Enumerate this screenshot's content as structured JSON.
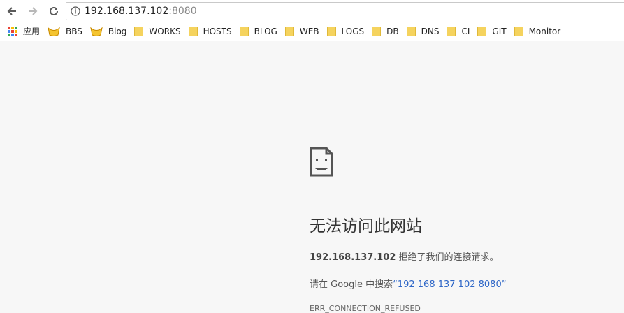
{
  "toolbar": {
    "back_icon": "arrow-left-icon",
    "forward_icon": "arrow-right-icon",
    "reload_icon": "reload-icon",
    "info_icon": "info-icon",
    "url_host": "192.168.137.102",
    "url_port": ":8080"
  },
  "bookmarks": {
    "apps_label": "应用",
    "items": [
      {
        "label": "BBS",
        "icon": "bbs-icon"
      },
      {
        "label": "Blog",
        "icon": "blog-icon"
      },
      {
        "label": "WORKS",
        "icon": "folder-icon"
      },
      {
        "label": "HOSTS",
        "icon": "folder-icon"
      },
      {
        "label": "BLOG",
        "icon": "folder-icon"
      },
      {
        "label": "WEB",
        "icon": "folder-icon"
      },
      {
        "label": "LOGS",
        "icon": "folder-icon"
      },
      {
        "label": "DB",
        "icon": "folder-icon"
      },
      {
        "label": "DNS",
        "icon": "folder-icon"
      },
      {
        "label": "CI",
        "icon": "folder-icon"
      },
      {
        "label": "GIT",
        "icon": "folder-icon"
      },
      {
        "label": "Monitor",
        "icon": "folder-icon"
      }
    ]
  },
  "error": {
    "icon": "sad-page-icon",
    "title": "无法访问此网站",
    "host": "192.168.137.102",
    "refused_text": " 拒绝了我们的连接请求。",
    "search_prefix": "请在 Google 中搜索",
    "search_link": "“192 168 137 102 8080”",
    "code": "ERR_CONNECTION_REFUSED"
  }
}
